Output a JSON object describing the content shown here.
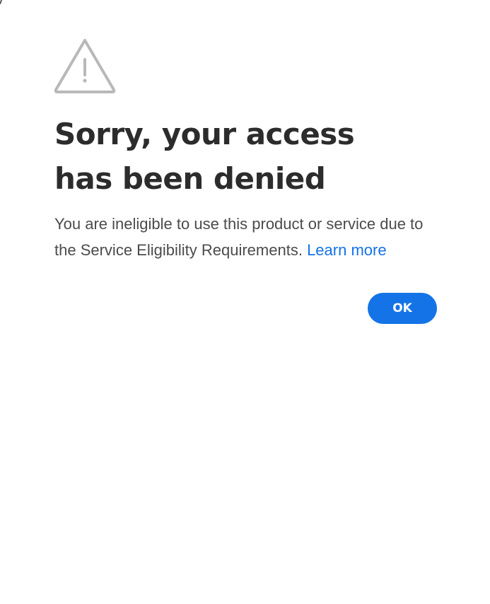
{
  "dialog": {
    "icon": "alert-triangle-icon",
    "title": "Sorry, your access has been denied",
    "message": "You are ineligible to use this product or service due to the Service Eligibility Requirements.",
    "learn_more_label": "Learn more",
    "ok_label": "OK"
  },
  "colors": {
    "accent": "#1473e6",
    "title_text": "#2c2c2c",
    "body_text": "#4b4b4b",
    "icon_stroke": "#b8b8b8",
    "background": "#ffffff"
  }
}
